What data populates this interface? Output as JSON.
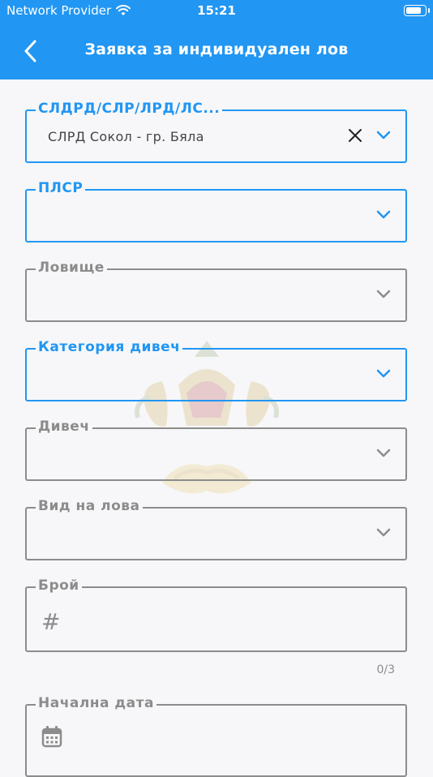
{
  "status": {
    "carrier": "Network Provider",
    "time": "15:21",
    "battery_level": 0.9
  },
  "header": {
    "title": "Заявка за индивидуален лов"
  },
  "icons": [
    "wifi-icon",
    "battery-icon",
    "back-arrow-icon",
    "clear-icon",
    "chevron-down-icon",
    "hash-icon",
    "calendar-icon",
    "emblem-watermark"
  ],
  "colors": {
    "primary": "#2196f3",
    "inactive": "#8c8c8c",
    "background": "#f7f7f9"
  },
  "form": {
    "organization": {
      "label": "СЛДРД/СЛР/ЛРД/ЛС...",
      "value": "СЛРД Сокол - гр. Бяла"
    },
    "plsr": {
      "label": "ПЛСР",
      "value": ""
    },
    "hunting_area": {
      "label": "Ловище",
      "value": ""
    },
    "game_category": {
      "label": "Категория дивеч",
      "value": ""
    },
    "game": {
      "label": "Дивеч",
      "value": ""
    },
    "hunt_type": {
      "label": "Вид на лова",
      "value": ""
    },
    "count": {
      "label": "Брой",
      "placeholder": "#",
      "counter": "0/3"
    },
    "start_date": {
      "label": "Начална дата"
    }
  }
}
